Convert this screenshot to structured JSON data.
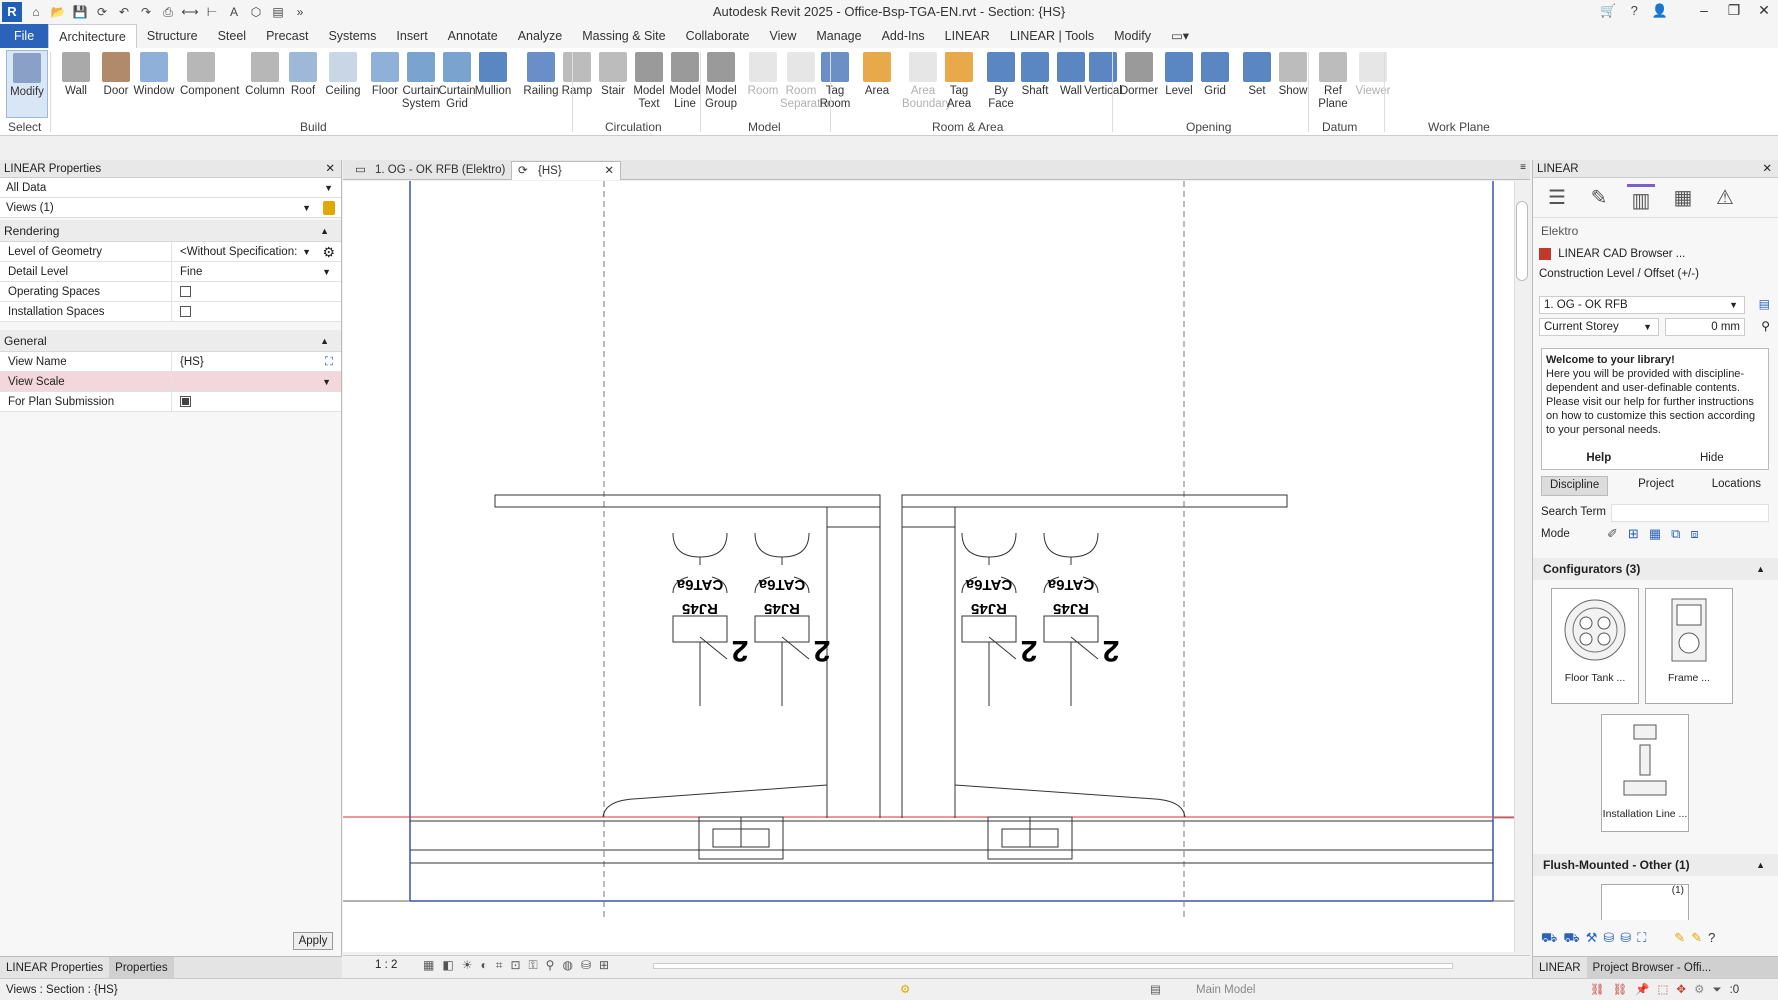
{
  "app": {
    "logo": "R",
    "title": "Autodesk Revit 2025 - Office-Bsp-TGA-EN.rvt - Section: {HS}"
  },
  "ribbon_tabs": [
    "File",
    "Architecture",
    "Structure",
    "Steel",
    "Precast",
    "Systems",
    "Insert",
    "Annotate",
    "Analyze",
    "Massing & Site",
    "Collaborate",
    "View",
    "Manage",
    "Add-Ins",
    "LINEAR",
    "LINEAR | Tools",
    "Modify"
  ],
  "ribbon": {
    "buttons": [
      {
        "label": "Modify",
        "icon": "cursor-icon"
      },
      {
        "label": "Wall",
        "icon": "wall-icon"
      },
      {
        "label": "Door",
        "icon": "door-icon"
      },
      {
        "label": "Window",
        "icon": "window-icon"
      },
      {
        "label": "Component",
        "icon": "component-icon"
      },
      {
        "label": "Column",
        "icon": "column-icon"
      },
      {
        "label": "Roof",
        "icon": "roof-icon"
      },
      {
        "label": "Ceiling",
        "icon": "ceiling-icon"
      },
      {
        "label": "Floor",
        "icon": "floor-icon"
      },
      {
        "label": "Curtain System",
        "icon": "curtain-system-icon"
      },
      {
        "label": "Curtain Grid",
        "icon": "curtain-grid-icon"
      },
      {
        "label": "Mullion",
        "icon": "mullion-icon"
      },
      {
        "label": "Railing",
        "icon": "railing-icon"
      },
      {
        "label": "Ramp",
        "icon": "ramp-icon"
      },
      {
        "label": "Stair",
        "icon": "stair-icon"
      },
      {
        "label": "Model Text",
        "icon": "model-text-icon"
      },
      {
        "label": "Model Line",
        "icon": "model-line-icon"
      },
      {
        "label": "Model Group",
        "icon": "model-group-icon"
      },
      {
        "label": "Room",
        "icon": "room-icon"
      },
      {
        "label": "Room Separator",
        "icon": "room-separator-icon"
      },
      {
        "label": "Tag Room",
        "icon": "tag-room-icon"
      },
      {
        "label": "Area",
        "icon": "area-icon"
      },
      {
        "label": "Area Boundary",
        "icon": "area-boundary-icon"
      },
      {
        "label": "Tag Area",
        "icon": "tag-area-icon"
      },
      {
        "label": "By Face",
        "icon": "by-face-icon"
      },
      {
        "label": "Shaft",
        "icon": "shaft-icon"
      },
      {
        "label": "Wall",
        "icon": "wall-opening-icon"
      },
      {
        "label": "Vertical",
        "icon": "vertical-icon"
      },
      {
        "label": "Dormer",
        "icon": "dormer-icon"
      },
      {
        "label": "Level",
        "icon": "level-icon"
      },
      {
        "label": "Grid",
        "icon": "grid-icon"
      },
      {
        "label": "Set",
        "icon": "set-icon"
      },
      {
        "label": "Show",
        "icon": "show-icon"
      },
      {
        "label": "Ref Plane",
        "icon": "ref-plane-icon"
      },
      {
        "label": "Viewer",
        "icon": "viewer-icon"
      }
    ],
    "groups": [
      "Select",
      "Build",
      "Circulation",
      "Model",
      "Room & Area",
      "Opening",
      "Datum",
      "Work Plane"
    ]
  },
  "left_panel": {
    "title": "LINEAR Properties",
    "filter": "All Data",
    "selector": "Views (1)",
    "sections": {
      "rendering": "Rendering",
      "general": "General"
    },
    "rendering_props": [
      {
        "key": "Level of Geometry",
        "value": "<Without Specification:"
      },
      {
        "key": "Detail Level",
        "value": "Fine"
      },
      {
        "key": "Operating Spaces",
        "value": ""
      },
      {
        "key": "Installation Spaces",
        "value": ""
      }
    ],
    "general_props": [
      {
        "key": "View Name",
        "value": "{HS}"
      },
      {
        "key": "View Scale",
        "value": ""
      },
      {
        "key": "For Plan Submission",
        "value": ""
      }
    ],
    "apply": "Apply",
    "tabs": [
      "LINEAR Properties",
      "Properties"
    ]
  },
  "view_tabs": [
    {
      "label": "1. OG - OK RFB (Elektro)"
    },
    {
      "label": "{HS}"
    }
  ],
  "drawing": {
    "labels": {
      "cat": "CAT6a",
      "rj": "RJ45",
      "count": "2"
    }
  },
  "view_control": {
    "scale": "1 : 2"
  },
  "right_panel": {
    "title": "LINEAR",
    "discipline": "Elektro",
    "cad_browser": "LINEAR CAD Browser ...",
    "construction_label": "Construction Level / Offset (+/-)",
    "level_value": "1. OG - OK RFB",
    "storey_value": "Current Storey",
    "offset_value": "0 mm",
    "welcome_title": "Welcome to your library!",
    "welcome_text": "Here you will be provided with discipline-dependent and user-definable contents. Please visit our help for further instructions on how to customize this section according to your personal needs.",
    "help": "Help",
    "hide": "Hide",
    "tabs": [
      "Discipline",
      "Project",
      "Locations"
    ],
    "search_label": "Search Term",
    "mode_label": "Mode",
    "configurators_label": "Configurators (3)",
    "cards": [
      "Floor Tank ...",
      "Frame ...",
      "Installation Line ..."
    ],
    "flush_label": "Flush-Mounted - Other (1)",
    "flush_count": "(1)",
    "bottom_tabs": [
      "LINEAR",
      "Project Browser - Offi..."
    ]
  },
  "status": {
    "text": "Views : Section : {HS}",
    "model": "Main Model",
    "selection_count": ":0"
  }
}
